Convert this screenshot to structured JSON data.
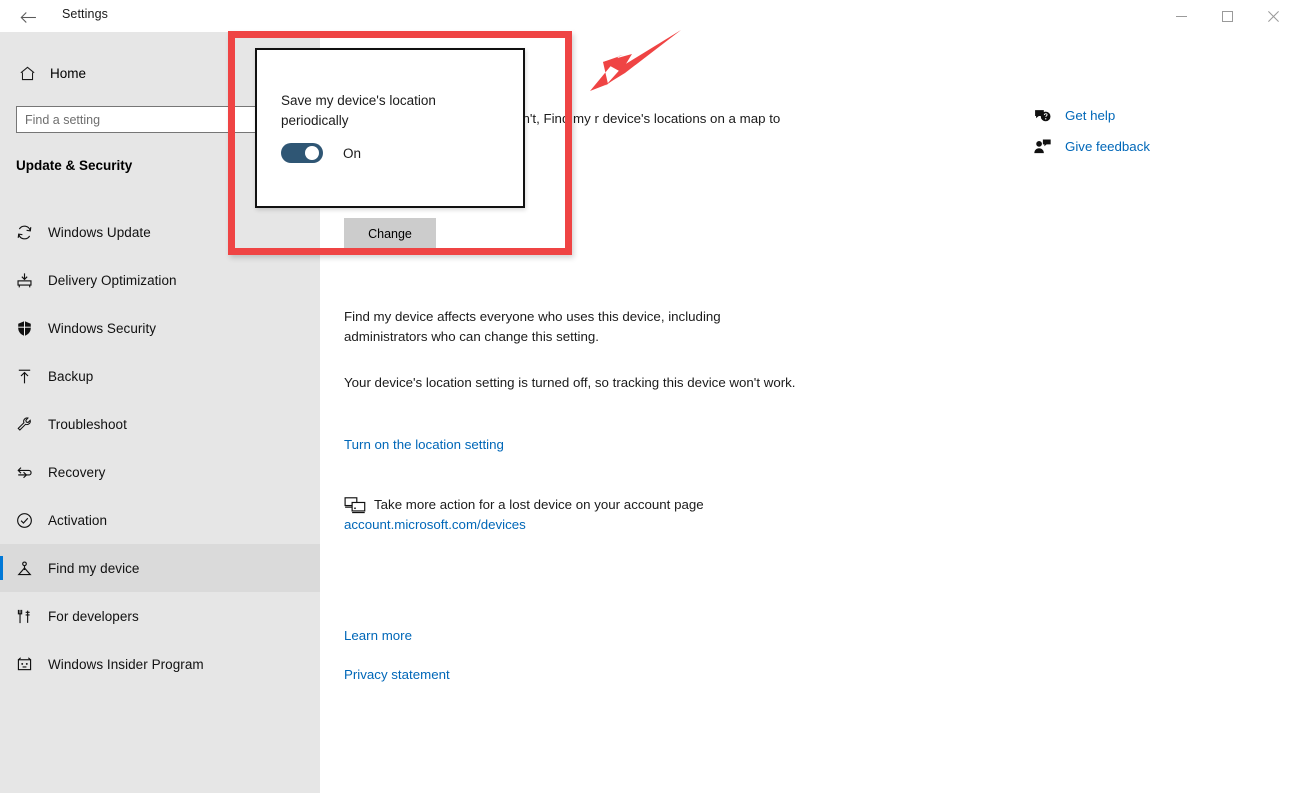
{
  "window": {
    "title": "Settings",
    "back_icon": "back-arrow-icon",
    "controls": {
      "minimize": "minimize-icon",
      "maximize": "maximize-icon",
      "close": "close-icon"
    }
  },
  "sidebar": {
    "home_label": "Home",
    "home_icon": "home-icon",
    "search": {
      "placeholder": "Find a setting",
      "value": ""
    },
    "category": "Update & Security",
    "items": [
      {
        "label": "Windows Update",
        "icon": "refresh-icon",
        "selected": false
      },
      {
        "label": "Delivery Optimization",
        "icon": "delivery-icon",
        "selected": false
      },
      {
        "label": "Windows Security",
        "icon": "shield-icon",
        "selected": false
      },
      {
        "label": "Backup",
        "icon": "upload-arrow-icon",
        "selected": false
      },
      {
        "label": "Troubleshoot",
        "icon": "wrench-icon",
        "selected": false
      },
      {
        "label": "Recovery",
        "icon": "recovery-icon",
        "selected": false
      },
      {
        "label": "Activation",
        "icon": "check-circle-icon",
        "selected": false
      },
      {
        "label": "Find my device",
        "icon": "find-device-icon",
        "selected": true
      },
      {
        "label": "For developers",
        "icon": "developer-tools-icon",
        "selected": false
      },
      {
        "label": "Windows Insider Program",
        "icon": "insider-icon",
        "selected": false
      }
    ]
  },
  "main": {
    "intro_paragraph": "you've lost it. Even if you haven't, Find my r device's locations on a map to help you",
    "change_button": "Change",
    "affects_paragraph": "Find my device affects everyone who uses this device, including administrators who can change this setting.",
    "location_off_paragraph": "Your device's location setting is turned off, so tracking this device won't work.",
    "turn_on_link": "Turn on the location setting",
    "account_row": {
      "icon": "devices-icon",
      "text": "Take more action for a lost device on your account page",
      "url_text": "account.microsoft.com/devices"
    },
    "learn_more_link": "Learn more",
    "privacy_link": "Privacy statement"
  },
  "rail": {
    "items": [
      {
        "label": "Get help",
        "icon": "question-chat-icon"
      },
      {
        "label": "Give feedback",
        "icon": "feedback-person-icon"
      }
    ]
  },
  "callout": {
    "title": "Save my device's location periodically",
    "toggle_state": "On",
    "toggle_on": true
  },
  "annotations": {
    "highlight_color": "#ef4444",
    "arrow_color": "#ef4444",
    "arrow_icon": "red-arrow-icon",
    "highlight_icon": "red-rectangle-highlight"
  },
  "colors": {
    "accent": "#0078d7",
    "link": "#0067b8",
    "sidebar_bg": "#e6e6e6",
    "toggle_on": "#2f5674"
  }
}
